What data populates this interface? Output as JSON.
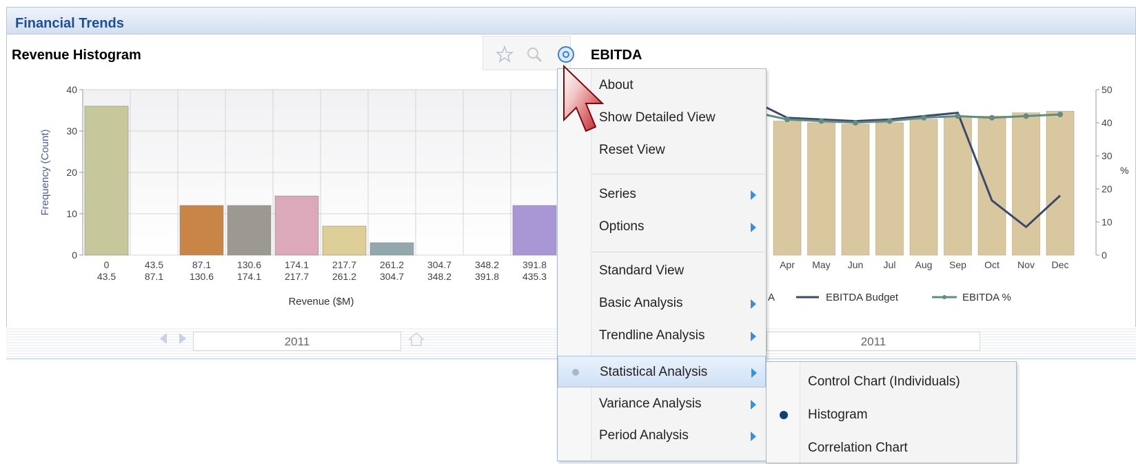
{
  "panel": {
    "title": "Financial Trends"
  },
  "revenue_histogram": {
    "title": "Revenue Histogram",
    "year": "2011"
  },
  "ebitda": {
    "title": "EBITDA",
    "year": "2011",
    "legend": {
      "partial": "A",
      "budget": "EBITDA Budget",
      "percent": "EBITDA %"
    }
  },
  "toolbar": {
    "icons": [
      "star-icon",
      "zoom-icon",
      "chart-options-icon"
    ]
  },
  "context_menu": {
    "items": [
      {
        "label": "About",
        "submenu": false
      },
      {
        "label": "Show Detailed View",
        "submenu": false
      },
      {
        "label": "Reset View",
        "submenu": false
      },
      {
        "label": "Series",
        "submenu": true
      },
      {
        "label": "Options",
        "submenu": true
      },
      {
        "label": "Standard View",
        "submenu": false
      },
      {
        "label": "Basic Analysis",
        "submenu": true
      },
      {
        "label": "Trendline Analysis",
        "submenu": true
      },
      {
        "label": "Statistical Analysis",
        "submenu": true,
        "active": true
      },
      {
        "label": "Variance Analysis",
        "submenu": true
      },
      {
        "label": "Period Analysis",
        "submenu": true
      }
    ]
  },
  "statistical_submenu": {
    "items": [
      {
        "label": "Control Chart (Individuals)",
        "selected": false
      },
      {
        "label": "Histogram",
        "selected": true
      },
      {
        "label": "Correlation Chart",
        "selected": false
      }
    ]
  },
  "chart_data": [
    {
      "type": "bar",
      "title": "Revenue Histogram",
      "xlabel": "Revenue ($M)",
      "ylabel": "Frequency (Count)",
      "ylim": [
        0,
        40
      ],
      "yticks": [
        0,
        10,
        20,
        30,
        40
      ],
      "grid": true,
      "categories": [
        [
          "0",
          "43.5"
        ],
        [
          "43.5",
          "87.1"
        ],
        [
          "87.1",
          "130.6"
        ],
        [
          "130.6",
          "174.1"
        ],
        [
          "174.1",
          "217.7"
        ],
        [
          "217.7",
          "261.2"
        ],
        [
          "261.2",
          "304.7"
        ],
        [
          "304.7",
          "348.2"
        ],
        [
          "348.2",
          "391.8"
        ],
        [
          "391.8",
          "435.3"
        ]
      ],
      "values": [
        36,
        0,
        12,
        12,
        14.3,
        7,
        3,
        0,
        0,
        12
      ],
      "colors": [
        "#c6c79a",
        "#d9d9d9",
        "#c98546",
        "#9c9993",
        "#dba9b9",
        "#ddcd96",
        "#92a8ad",
        "#d9d9d9",
        "#d9d9d9",
        "#a996d4"
      ]
    },
    {
      "type": "bar",
      "title": "EBITDA",
      "ylabel_right": "%",
      "y2lim": [
        0,
        50
      ],
      "y2ticks": [
        0,
        10,
        20,
        30,
        40,
        50
      ],
      "categories": [
        "Apr",
        "May",
        "Jun",
        "Jul",
        "Aug",
        "Sep",
        "Oct",
        "Nov",
        "Dec"
      ],
      "series": [
        {
          "name": "A",
          "kind": "bar",
          "color": "#d9c79f",
          "values": [
            40.5,
            40,
            39.5,
            40,
            41,
            42,
            42,
            43,
            43.5
          ]
        },
        {
          "name": "EBITDA Budget",
          "kind": "line",
          "color": "#3b4a6b",
          "values": [
            41.5,
            41,
            40.5,
            41,
            42,
            43,
            16.5,
            8.5,
            18
          ]
        },
        {
          "name": "EBITDA %",
          "kind": "line",
          "color": "#5f8c84",
          "values": [
            41,
            40.5,
            40,
            40.5,
            41.5,
            42,
            41.5,
            42,
            42.5
          ]
        }
      ]
    }
  ]
}
